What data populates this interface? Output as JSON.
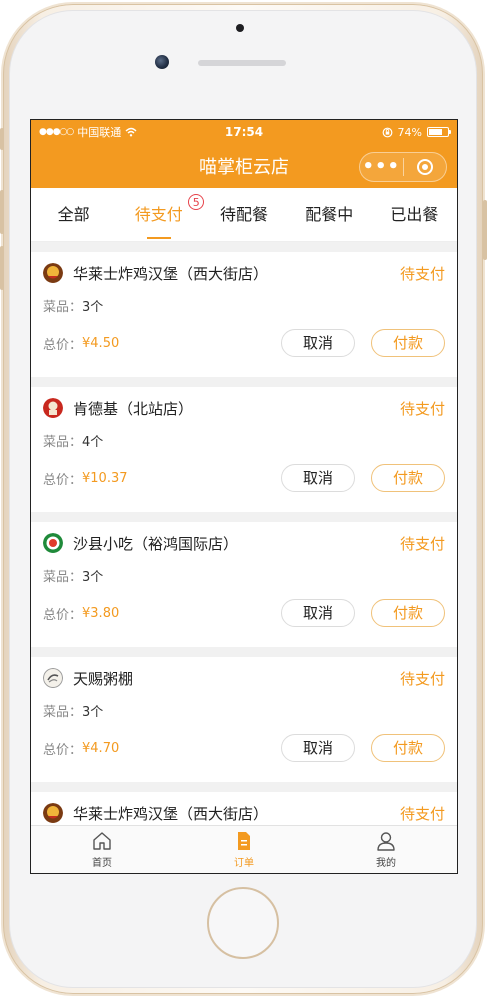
{
  "status_bar": {
    "signal": "●●●○○",
    "carrier": "中国联通",
    "wifi_icon": "wifi-icon",
    "time": "17:54",
    "battery_percent": "74%",
    "battery_level": 0.74
  },
  "navbar": {
    "title": "喵掌柜云店",
    "more_label": "•••"
  },
  "tabs": [
    {
      "label": "全部"
    },
    {
      "label": "待支付",
      "badge": "5"
    },
    {
      "label": "待配餐"
    },
    {
      "label": "配餐中"
    },
    {
      "label": "已出餐"
    }
  ],
  "orders": [
    {
      "store": "华莱士炸鸡汉堡（西大街店）",
      "status": "待支付",
      "items_label": "菜品：",
      "items_count": "3个",
      "total_label": "总价：",
      "total": "¥4.50",
      "cancel": "取消",
      "pay": "付款"
    },
    {
      "store": "肯德基（北站店）",
      "status": "待支付",
      "items_label": "菜品：",
      "items_count": "4个",
      "total_label": "总价：",
      "total": "¥10.37",
      "cancel": "取消",
      "pay": "付款"
    },
    {
      "store": "沙县小吃（裕鸿国际店）",
      "status": "待支付",
      "items_label": "菜品：",
      "items_count": "3个",
      "total_label": "总价：",
      "total": "¥3.80",
      "cancel": "取消",
      "pay": "付款"
    },
    {
      "store": "天赐粥棚",
      "status": "待支付",
      "items_label": "菜品：",
      "items_count": "3个",
      "total_label": "总价：",
      "total": "¥4.70",
      "cancel": "取消",
      "pay": "付款"
    },
    {
      "store": "华莱士炸鸡汉堡（西大街店）",
      "status": "待支付"
    }
  ],
  "tabbar": [
    {
      "label": "首页",
      "icon": "home-icon"
    },
    {
      "label": "订单",
      "icon": "order-icon"
    },
    {
      "label": "我的",
      "icon": "profile-icon"
    }
  ],
  "colors": {
    "accent": "#f39a20",
    "badge": "#e6434b",
    "background": "#f1f1f1"
  }
}
